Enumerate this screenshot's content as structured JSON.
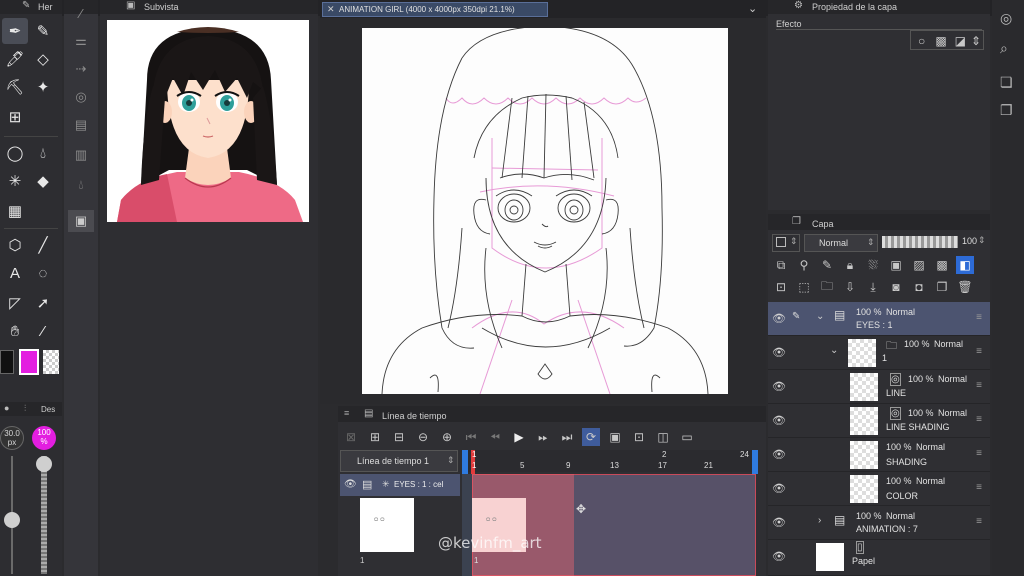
{
  "left_toolbar": {
    "tab_label": "Her",
    "brush_size_label": "30.0",
    "brush_size_unit": "px",
    "opacity_label": "100",
    "opacity_unit": "%",
    "sub_tab_label": "Des",
    "main_color": "#e31ee0",
    "size_level": 0.45,
    "opacity_level": 1.0
  },
  "subview": {
    "title": "Subvista"
  },
  "document_tab": {
    "title": "ANIMATION GIRL (4000 x 4000px 350dpi 21.1%)"
  },
  "properties": {
    "title": "Propiedad de la capa",
    "effect_label": "Efecto"
  },
  "layers": {
    "title": "Capa",
    "blend_mode": "Normal",
    "opacity": "100",
    "rows": [
      {
        "pct": "100 %",
        "mode": "Normal",
        "name": "EYES : 1"
      },
      {
        "pct": "100 %",
        "mode": "Normal",
        "name": "1"
      },
      {
        "pct": "100 %",
        "mode": "Normal",
        "name": "LINE"
      },
      {
        "pct": "100 %",
        "mode": "Normal",
        "name": "LINE SHADING"
      },
      {
        "pct": "100 %",
        "mode": "Normal",
        "name": "SHADING"
      },
      {
        "pct": "100 %",
        "mode": "Normal",
        "name": "COLOR"
      },
      {
        "pct": "100 %",
        "mode": "Normal",
        "name": "ANIMATION : 7"
      },
      {
        "pct": "",
        "mode": "",
        "name": "Papel"
      }
    ]
  },
  "timeline": {
    "title": "Línea de tiempo",
    "selector": "Línea de tiempo 1",
    "track_label": "EYES : 1 : cel",
    "frame_label_1": "1",
    "ruler_top": [
      "1",
      "2",
      "24"
    ],
    "ruler_bottom": [
      "1",
      "5",
      "9",
      "13",
      "17",
      "21"
    ]
  },
  "watermark": "@kevinfm_art"
}
